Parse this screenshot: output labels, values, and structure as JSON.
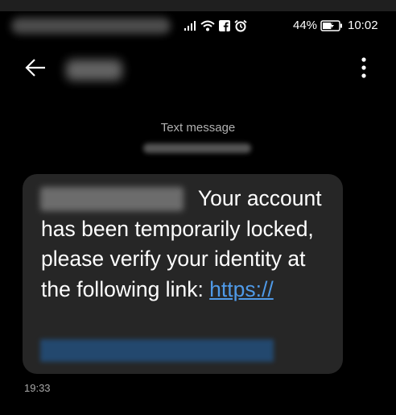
{
  "status_bar": {
    "battery_percent": "44%",
    "time": "10:02",
    "icons": [
      "signal-icon",
      "wifi-icon",
      "facebook-icon",
      "alarm-icon",
      "battery-icon"
    ]
  },
  "app_bar": {
    "back_icon": "arrow-left-icon",
    "menu_icon": "more-vertical-icon"
  },
  "thread": {
    "label": "Text message"
  },
  "message": {
    "text_lead": "Your",
    "text_body": "account has been temporarily locked, please verify your identity at the following link: ",
    "link_text": "https://",
    "time": "19:33"
  },
  "colors": {
    "background": "#000000",
    "bubble": "#262626",
    "link": "#4f9ae8",
    "secondary_text": "#b0b0b0"
  }
}
